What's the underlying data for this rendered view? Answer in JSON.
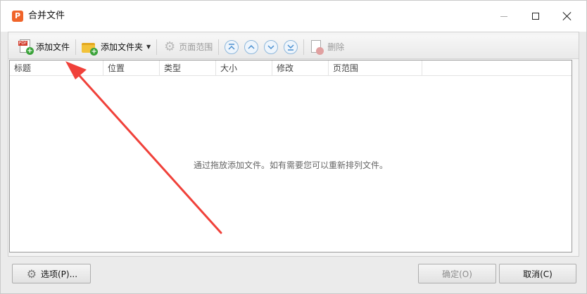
{
  "window": {
    "title": "合并文件",
    "app_icon_letter": "P"
  },
  "toolbar": {
    "add_file": "添加文件",
    "add_folder": "添加文件夹",
    "page_range": "页面范围",
    "delete": "删除"
  },
  "table": {
    "columns": [
      "标题",
      "位置",
      "类型",
      "大小",
      "修改",
      "页范围"
    ]
  },
  "list": {
    "empty_message": "通过拖放添加文件。如有需要您可以重新排列文件。"
  },
  "footer": {
    "options": "选项(P)...",
    "ok": "确定(O)",
    "cancel": "取消(C)"
  },
  "colors": {
    "arrow": "#f0413a",
    "app_icon": "#f0642a"
  }
}
